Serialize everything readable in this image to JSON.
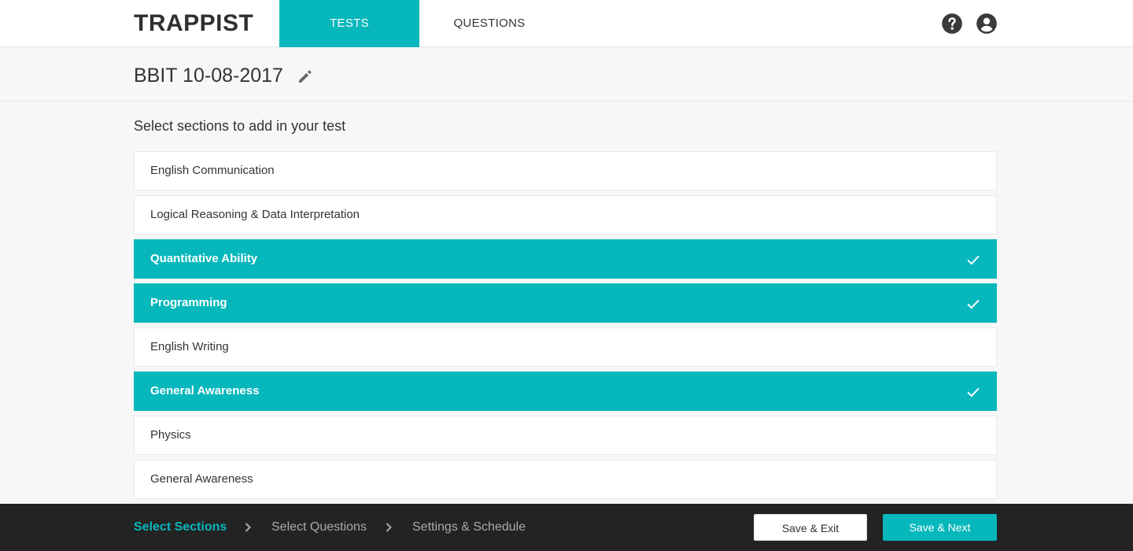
{
  "header": {
    "logo": "TRAPPIST",
    "tabs": [
      {
        "label": "TESTS",
        "active": true
      },
      {
        "label": "QUESTIONS",
        "active": false
      }
    ],
    "icons": [
      "help-icon",
      "account-circle-icon"
    ]
  },
  "test": {
    "title": "BBIT 10-08-2017",
    "edit_icon": "pencil-icon"
  },
  "sections_prompt": "Select sections to add in your test",
  "sections": [
    {
      "label": "English Communication",
      "selected": false
    },
    {
      "label": "Logical Reasoning & Data Interpretation",
      "selected": false
    },
    {
      "label": "Quantitative Ability",
      "selected": true
    },
    {
      "label": "Programming",
      "selected": true
    },
    {
      "label": "English Writing",
      "selected": false
    },
    {
      "label": "General Awareness",
      "selected": true
    },
    {
      "label": "Physics",
      "selected": false
    },
    {
      "label": "General Awareness",
      "selected": false
    }
  ],
  "footer": {
    "steps": [
      {
        "label": "Select Sections",
        "active": true
      },
      {
        "label": "Select Questions",
        "active": false
      },
      {
        "label": "Settings & Schedule",
        "active": false
      }
    ],
    "save_exit_label": "Save & Exit",
    "save_next_label": "Save & Next"
  },
  "colors": {
    "accent": "#06b7bc",
    "footer_bg": "#232323",
    "page_bg": "#f7f7f7"
  }
}
